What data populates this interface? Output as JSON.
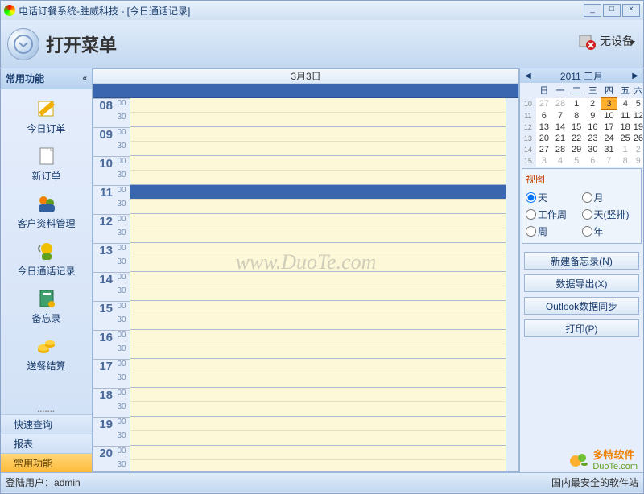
{
  "title": "电话订餐系统-胜威科技 - [今日通话记录]",
  "orb_label": "打开菜单",
  "device_status": "无设备",
  "sidebar": {
    "header": "常用功能",
    "items": [
      {
        "label": "今日订单",
        "icon": "order-today"
      },
      {
        "label": "新订单",
        "icon": "new-order"
      },
      {
        "label": "客户资料管理",
        "icon": "customers"
      },
      {
        "label": "今日通话记录",
        "icon": "call-log"
      },
      {
        "label": "备忘录",
        "icon": "memo"
      },
      {
        "label": "送餐结算",
        "icon": "settlement"
      }
    ],
    "nav": [
      {
        "label": "快速查询",
        "active": false
      },
      {
        "label": "报表",
        "active": false
      },
      {
        "label": "常用功能",
        "active": true
      }
    ]
  },
  "calendar_view": {
    "date_header": "3月3日",
    "hours": [
      8,
      9,
      10,
      11,
      12,
      13,
      14,
      15,
      16,
      17,
      18,
      19,
      20
    ],
    "current_hour": 11,
    "watermark": "www.DuoTe.com"
  },
  "mini_calendar": {
    "title": "2011 三月",
    "dow": [
      "日",
      "一",
      "二",
      "三",
      "四",
      "五",
      "六"
    ],
    "weeks": [
      {
        "wk": 10,
        "days": [
          {
            "d": 27,
            "dim": true
          },
          {
            "d": 28,
            "dim": true
          },
          {
            "d": 1
          },
          {
            "d": 2
          },
          {
            "d": 3,
            "today": true
          },
          {
            "d": 4
          },
          {
            "d": 5
          }
        ]
      },
      {
        "wk": 11,
        "days": [
          {
            "d": 6
          },
          {
            "d": 7
          },
          {
            "d": 8
          },
          {
            "d": 9
          },
          {
            "d": 10
          },
          {
            "d": 11
          },
          {
            "d": 12
          }
        ]
      },
      {
        "wk": 12,
        "days": [
          {
            "d": 13
          },
          {
            "d": 14
          },
          {
            "d": 15
          },
          {
            "d": 16
          },
          {
            "d": 17
          },
          {
            "d": 18
          },
          {
            "d": 19
          }
        ]
      },
      {
        "wk": 13,
        "days": [
          {
            "d": 20
          },
          {
            "d": 21
          },
          {
            "d": 22
          },
          {
            "d": 23
          },
          {
            "d": 24
          },
          {
            "d": 25
          },
          {
            "d": 26
          }
        ]
      },
      {
        "wk": 14,
        "days": [
          {
            "d": 27
          },
          {
            "d": 28
          },
          {
            "d": 29
          },
          {
            "d": 30
          },
          {
            "d": 31
          },
          {
            "d": 1,
            "dim": true
          },
          {
            "d": 2,
            "dim": true
          }
        ]
      },
      {
        "wk": 15,
        "days": [
          {
            "d": 3,
            "dim": true
          },
          {
            "d": 4,
            "dim": true
          },
          {
            "d": 5,
            "dim": true
          },
          {
            "d": 6,
            "dim": true
          },
          {
            "d": 7,
            "dim": true
          },
          {
            "d": 8,
            "dim": true
          },
          {
            "d": 9,
            "dim": true
          }
        ]
      }
    ]
  },
  "view_panel": {
    "title": "视图",
    "options": [
      {
        "label": "天",
        "checked": true
      },
      {
        "label": "月",
        "checked": false
      },
      {
        "label": "工作周",
        "checked": false
      },
      {
        "label": "天(竖排)",
        "checked": false
      },
      {
        "label": "周",
        "checked": false
      },
      {
        "label": "年",
        "checked": false
      }
    ]
  },
  "action_buttons": [
    "新建备忘录(N)",
    "数据导出(X)",
    "Outlook数据同步",
    "打印(P)"
  ],
  "status": {
    "user_label": "登陆用户：",
    "user": "admin",
    "right": "国内最安全的软件站"
  },
  "brand": {
    "name": "多特软件",
    "url": "DuoTe.com"
  }
}
